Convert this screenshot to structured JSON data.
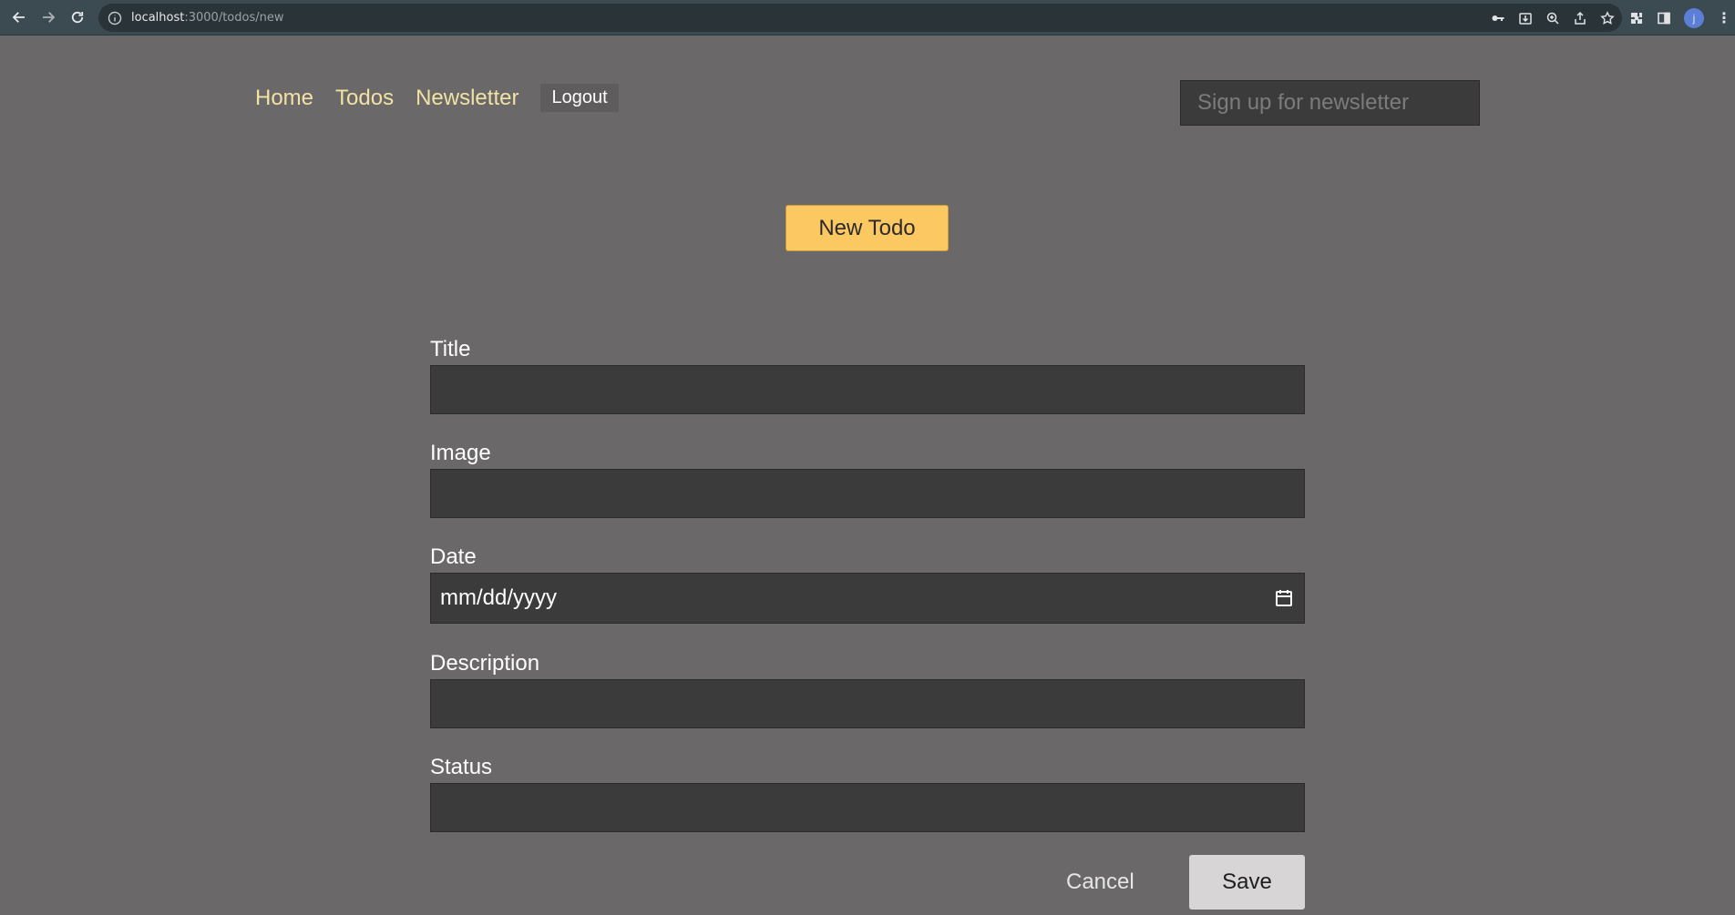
{
  "browser": {
    "url_host": "localhost",
    "url_path": ":3000/todos/new",
    "profile_initial": "j"
  },
  "nav": {
    "home": "Home",
    "todos": "Todos",
    "newsletter": "Newsletter",
    "logout": "Logout"
  },
  "newsletter_input": {
    "placeholder": "Sign up for newsletter"
  },
  "header": {
    "new_todo_label": "New Todo"
  },
  "form": {
    "title_label": "Title",
    "title_value": "",
    "image_label": "Image",
    "image_value": "",
    "date_label": "Date",
    "date_placeholder": "mm/dd/yyyy",
    "description_label": "Description",
    "description_value": "",
    "status_label": "Status",
    "status_value": "",
    "cancel_label": "Cancel",
    "save_label": "Save"
  },
  "colors": {
    "page_bg": "#6a6869",
    "nav_link": "#f2e2a4",
    "accent_button": "#fcc862",
    "input_bg": "#3b3b3b"
  }
}
